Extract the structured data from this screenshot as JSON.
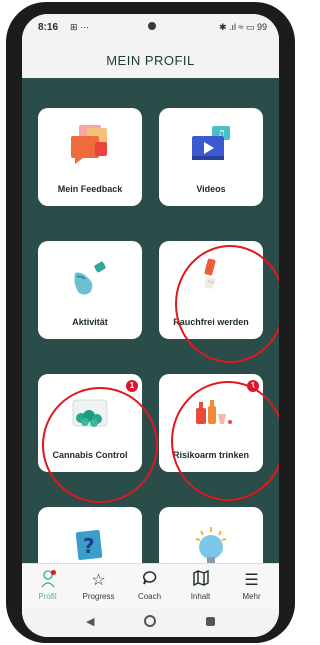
{
  "status_bar": {
    "time": "8:16",
    "left_icons": "⊞ ···",
    "right_icons": "✱ .ıl ≈ ▭ 99"
  },
  "header": {
    "title": "MEIN PROFIL"
  },
  "cards": [
    {
      "label": "Mein Feedback",
      "icon": "chat-bubbles-illustration",
      "badge": ""
    },
    {
      "label": "Videos",
      "icon": "video-player-illustration",
      "badge": ""
    },
    {
      "label": "Aktivität",
      "icon": "running-shoe-illustration",
      "badge": ""
    },
    {
      "label": "Rauchfrei werden",
      "icon": "broken-cigarette-illustration",
      "badge": ""
    },
    {
      "label": "Cannabis Control",
      "icon": "cannabis-jar-illustration",
      "badge": "1"
    },
    {
      "label": "Risikoarm trinken",
      "icon": "bottles-illustration",
      "badge": "1"
    },
    {
      "label": "",
      "icon": "question-box-illustration",
      "badge": ""
    },
    {
      "label": "",
      "icon": "lightbulb-illustration",
      "badge": ""
    }
  ],
  "bottom_nav": [
    {
      "label": "Profil",
      "icon": "person-icon"
    },
    {
      "label": "Progress",
      "icon": "star-icon"
    },
    {
      "label": "Coach",
      "icon": "speech-bubble-icon"
    },
    {
      "label": "Inhalt",
      "icon": "map-icon"
    },
    {
      "label": "Mehr",
      "icon": "hamburger-menu-icon"
    }
  ],
  "colors": {
    "background": "#2b4d4a",
    "accent": "#5ab0a8",
    "badge": "#d9172e",
    "highlight_ring": "#e0181e"
  }
}
